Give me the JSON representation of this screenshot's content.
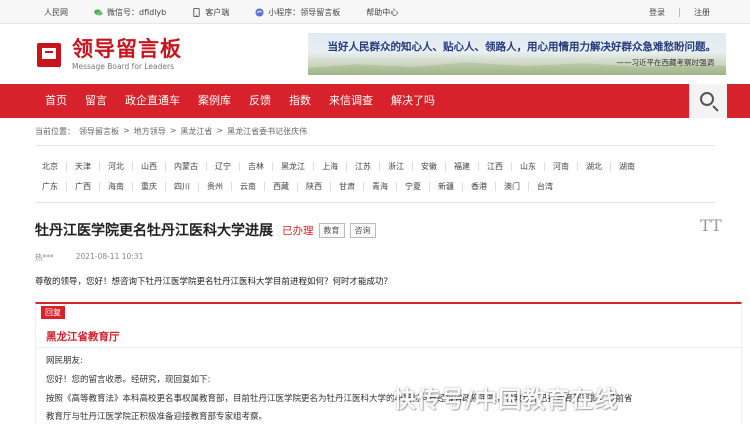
{
  "topbar": {
    "people": "人民网",
    "wechat": "微信号：dfldlyb",
    "client": "客户端",
    "miniapp": "小程序：领导留言板",
    "help": "帮助中心",
    "login": "登录",
    "register": "注册"
  },
  "logo": {
    "cn": "领导留言板",
    "en": "Message Board for Leaders"
  },
  "banner": {
    "quote": "当好人民群众的知心人、贴心人、领路人，用心用情用力解决好群众急难愁盼问题。",
    "attribution": "——习近平在西藏考察时强调"
  },
  "nav": [
    "首页",
    "留言",
    "政企直通车",
    "案例库",
    "反馈",
    "指数",
    "来信调查",
    "解决了吗"
  ],
  "breadcrumb": [
    "当前位置：",
    "领导留言板",
    ">",
    "地方领导",
    ">",
    "黑龙江省",
    ">",
    "黑龙江省委书记张庆伟"
  ],
  "regions": {
    "row1": [
      "北京",
      "天津",
      "河北",
      "山西",
      "内蒙古",
      "辽宁",
      "吉林",
      "黑龙江",
      "上海",
      "江苏",
      "浙江",
      "安徽",
      "福建",
      "江西",
      "山东",
      "河南",
      "湖北",
      "湖南"
    ],
    "row2": [
      "广东",
      "广西",
      "海南",
      "重庆",
      "四川",
      "贵州",
      "云南",
      "西藏",
      "陕西",
      "甘肃",
      "青海",
      "宁夏",
      "新疆",
      "香港",
      "澳门",
      "台湾"
    ]
  },
  "article": {
    "title": "牡丹江医学院更名牡丹江医科大学进展",
    "status": "已办理",
    "tags": [
      "教育",
      "咨询"
    ],
    "font_toggle": "TT",
    "author": "热***",
    "time": "2021-08-11 10:31",
    "question": "尊敬的领导，您好！想咨询下牡丹江医学院更名牡丹江医科大学目前进程如何？何时才能成功？"
  },
  "reply": {
    "label": "回复",
    "department": "黑龙江省教育厅",
    "lines": [
      "网民朋友:",
      "您好！您的留言收悉。经研究，现回复如下:",
      "按照《高等教育法》本科高校更名事权属教育部，目前牡丹江医学院更名为牡丹江医科大学的申报材料已经报省政府审批，省教育厅已报教育部审批，目前省",
      "教育厅与牡丹江医学院正积极准备迎接教育部专家组考察。"
    ]
  },
  "watermark": "快传号/中国教育在线",
  "colors": {
    "brand_red": "#d7222b",
    "logo_red": "#c8141e",
    "banner_text": "#243b7a"
  }
}
